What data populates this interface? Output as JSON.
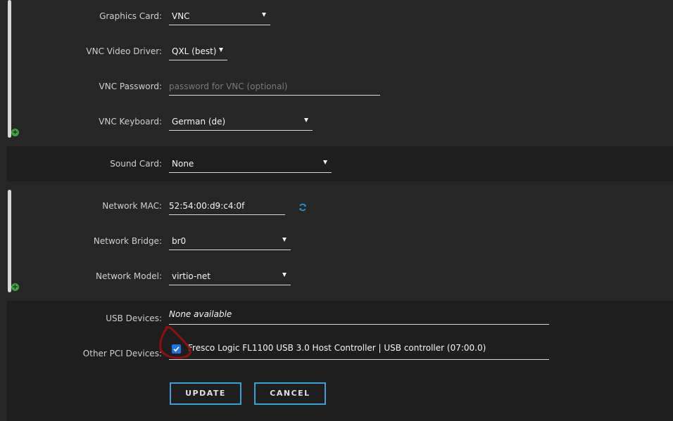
{
  "graphics": {
    "graphics_card": {
      "label": "Graphics Card",
      "value": "VNC"
    },
    "vnc_video_driver": {
      "label": "VNC Video Driver",
      "value": "QXL (best)"
    },
    "vnc_password": {
      "label": "VNC Password",
      "value": "",
      "placeholder": "password for VNC (optional)"
    },
    "vnc_keyboard": {
      "label": "VNC Keyboard",
      "value": "German (de)"
    }
  },
  "sound": {
    "sound_card": {
      "label": "Sound Card",
      "value": "None"
    }
  },
  "network": {
    "mac": {
      "label": "Network MAC",
      "value": "52:54:00:d9:c4:0f"
    },
    "bridge": {
      "label": "Network Bridge",
      "value": "br0"
    },
    "model": {
      "label": "Network Model",
      "value": "virtio-net"
    }
  },
  "usb": {
    "usb_devices": {
      "label": "USB Devices",
      "value": "None available"
    },
    "other_pci": {
      "label": "Other PCI Devices",
      "checked": true,
      "item": "Fresco Logic FL1100 USB 3.0 Host Controller | USB controller (07:00.0)"
    }
  },
  "actions": {
    "update_label": "UPDATE",
    "cancel_label": "CANCEL"
  },
  "colors": {
    "accent": "#3aa0d8",
    "add_icon": "#3aa53a",
    "checkbox": "#1a73e8",
    "annotation": "#8b1010"
  },
  "icons": [
    "plus-circle-icon",
    "refresh-icon",
    "checkmark-icon",
    "caret-down-icon"
  ]
}
